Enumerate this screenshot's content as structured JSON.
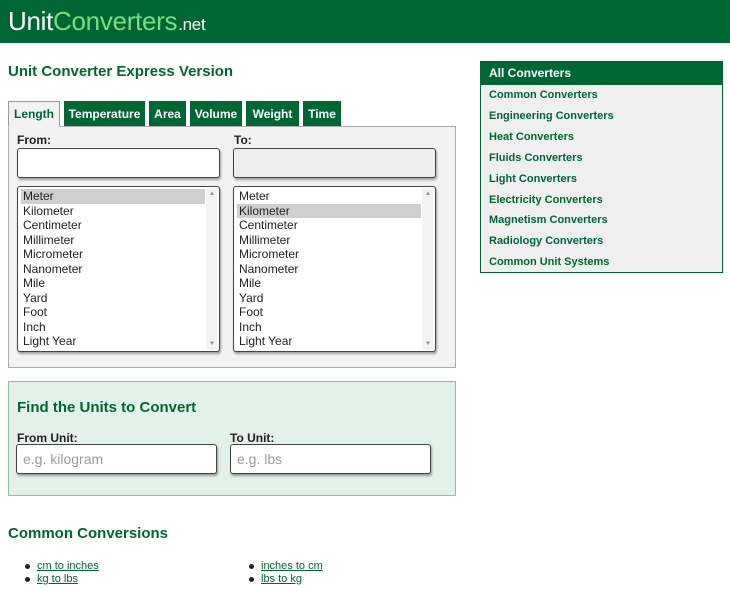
{
  "header": {
    "logo_part1": "Unit",
    "logo_part2": "Converters",
    "logo_part3": ".net"
  },
  "page_title": "Unit Converter Express Version",
  "tabs": [
    {
      "label": "Length",
      "active": true
    },
    {
      "label": "Temperature",
      "active": false
    },
    {
      "label": "Area",
      "active": false
    },
    {
      "label": "Volume",
      "active": false
    },
    {
      "label": "Weight",
      "active": false
    },
    {
      "label": "Time",
      "active": false
    }
  ],
  "converter": {
    "from_label": "From:",
    "to_label": "To:",
    "from_value": "",
    "to_value": "",
    "from_selected": "Meter",
    "to_selected": "Kilometer",
    "units": [
      "Meter",
      "Kilometer",
      "Centimeter",
      "Millimeter",
      "Micrometer",
      "Nanometer",
      "Mile",
      "Yard",
      "Foot",
      "Inch",
      "Light Year"
    ]
  },
  "find": {
    "title": "Find the Units to Convert",
    "from_label": "From Unit:",
    "to_label": "To Unit:",
    "from_placeholder": "e.g. kilogram",
    "to_placeholder": "e.g. lbs"
  },
  "common": {
    "title": "Common Conversions",
    "left": [
      "cm to inches",
      "kg to lbs"
    ],
    "right": [
      "inches to cm",
      "lbs to kg"
    ]
  },
  "sidebar": {
    "header": "All Converters",
    "items": [
      "Common Converters",
      "Engineering Converters",
      "Heat Converters",
      "Fluids Converters",
      "Light Converters",
      "Electricity Converters",
      "Magnetism Converters",
      "Radiology Converters",
      "Common Unit Systems"
    ]
  },
  "colors": {
    "brand_green": "#006633",
    "logo_accent": "#7ddc7d",
    "find_panel_bg": "#e2f1e9"
  }
}
